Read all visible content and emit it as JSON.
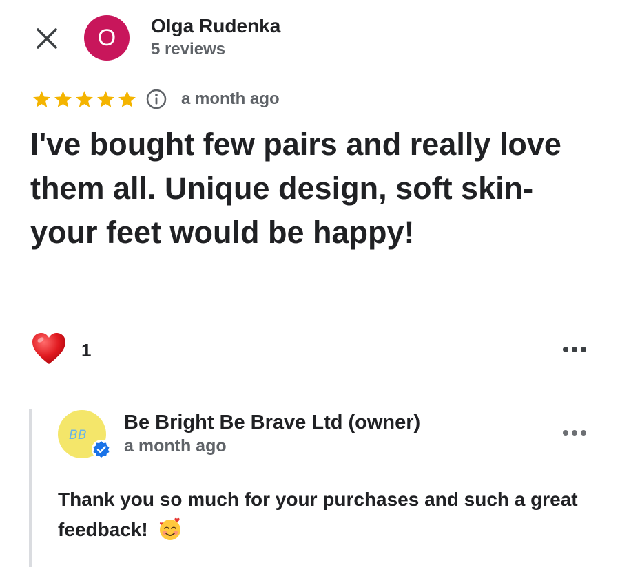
{
  "reviewer": {
    "initial": "O",
    "name": "Olga Rudenka",
    "meta": "5 reviews",
    "avatar_color": "#c8165b"
  },
  "review": {
    "rating": 5,
    "date": "a month ago",
    "text": "I've bought few pairs and really love them all. Unique design, soft skin-your feet would be happy!",
    "star_color": "#f4b400"
  },
  "reactions": {
    "icon": "heart-icon",
    "count": "1"
  },
  "owner_reply": {
    "name": "Be Bright Be Brave Ltd (owner)",
    "date": "a month ago",
    "avatar_text": "BB",
    "avatar_color": "#f4e66a",
    "text": "Thank you so much for your purchases and such a great feedback!",
    "emoji": "smiling-face-with-hearts-icon"
  }
}
